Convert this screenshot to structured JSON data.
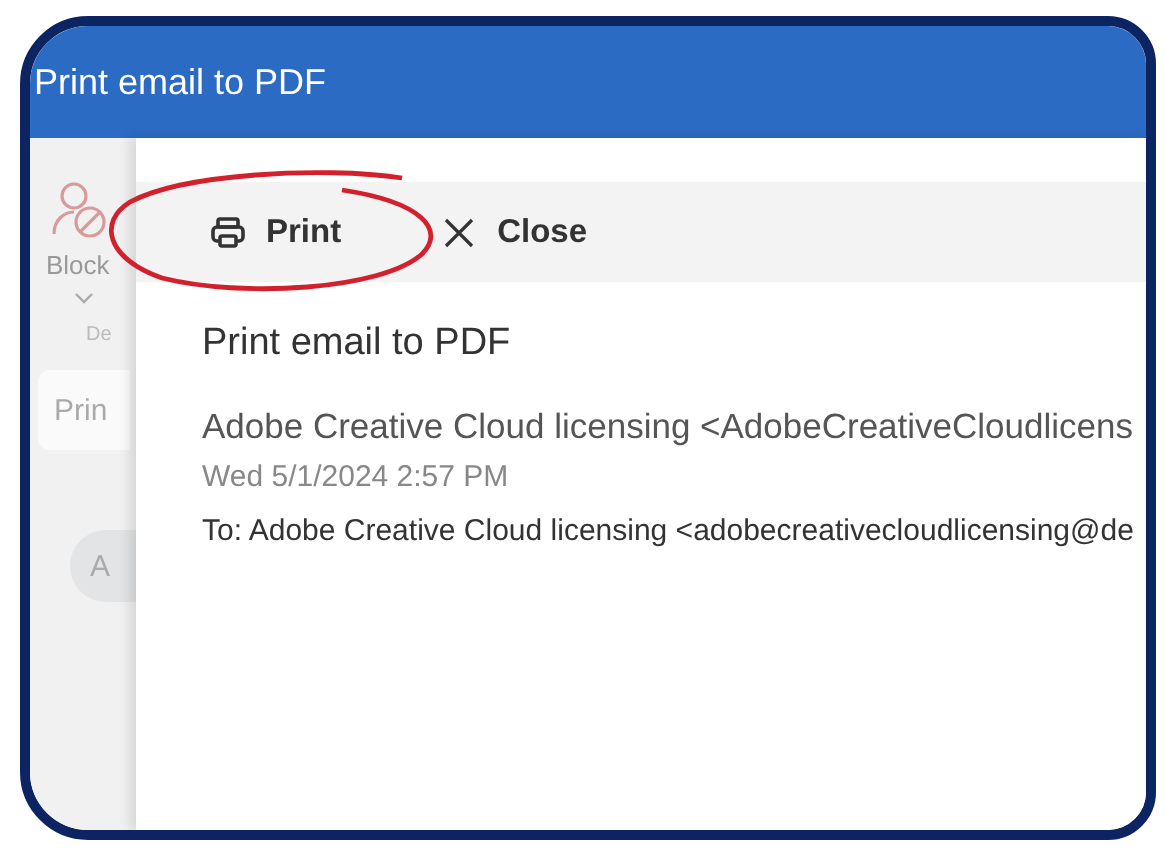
{
  "window": {
    "title": "Print email to PDF"
  },
  "background": {
    "block_label": "Block",
    "group_label": "De",
    "button": "Prin",
    "avatar": "A"
  },
  "toolbar": [
    {
      "kind": "print",
      "label": "Print",
      "circled": true
    },
    {
      "kind": "close",
      "label": "Close",
      "circled": false
    }
  ],
  "email": {
    "subject": "Print email to PDF",
    "sender": "Adobe Creative Cloud licensing <AdobeCreativeCloudlicens",
    "date": "Wed 5/1/2024 2:57 PM",
    "to": "To:  Adobe Creative Cloud licensing <adobecreativecloudlicensing@de"
  }
}
